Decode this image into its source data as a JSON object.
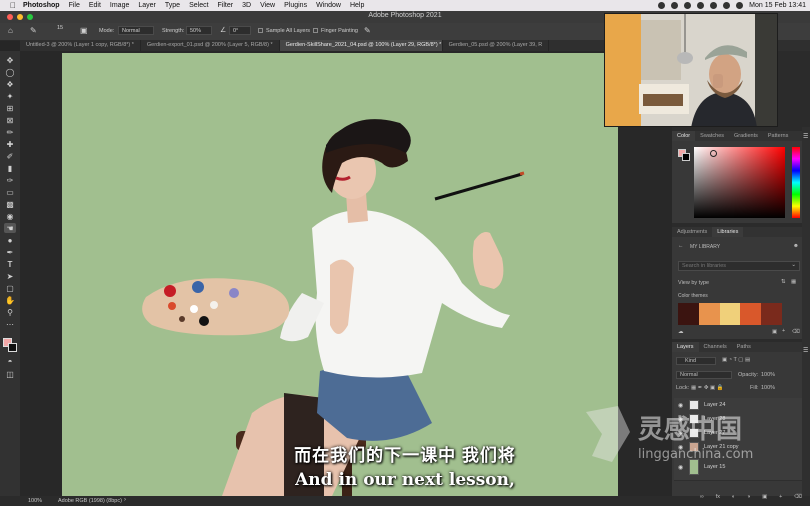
{
  "menubar": {
    "items": [
      "Photoshop",
      "File",
      "Edit",
      "Image",
      "Layer",
      "Type",
      "Select",
      "Filter",
      "3D",
      "View",
      "Plugins",
      "Window",
      "Help"
    ],
    "datetime": "Mon 15 Feb  13:41"
  },
  "titlebar": {
    "title": "Adobe Photoshop 2021"
  },
  "options": {
    "brush_size": "15",
    "mode_label": "Mode:",
    "mode_value": "Normal",
    "strength_label": "Strength:",
    "strength_value": "50%",
    "angle_value": "0°",
    "sample_all_layers": "Sample All Layers",
    "finger_painting": "Finger Painting"
  },
  "tabs": [
    {
      "label": "Untitled-3 @ 200% (Layer 1 copy, RGB/8*) *",
      "active": false
    },
    {
      "label": "Gerdien-export_01.psd @ 200% (Layer 5, RGB/8) *",
      "active": false
    },
    {
      "label": "Gerdien-SkillShare_2021_04.psd @ 100% (Layer 29, RGB/8*) *",
      "active": true
    },
    {
      "label": "Gerdien_05.psd @ 200% (Layer 39, R",
      "active": false
    }
  ],
  "status": {
    "zoom": "100%",
    "profile": "Adobe RGB (1998) (8bpc)"
  },
  "panels": {
    "color_tabs": [
      "Color",
      "Swatches",
      "Gradients",
      "Patterns"
    ],
    "lib_tabs": [
      "Adjustments",
      "Libraries"
    ],
    "my_library": "MY LIBRARY",
    "search_placeholder": "Search in libraries",
    "view_by": "View by type",
    "color_themes": "Color themes",
    "theme_colors": [
      "#3b1410",
      "#e8934d",
      "#f0d07a",
      "#d9582b",
      "#7a2a1c"
    ],
    "layer_tabs": [
      "Layers",
      "Channels",
      "Paths"
    ],
    "kind": "Kind",
    "blend": "Normal",
    "opacity_label": "Opacity:",
    "opacity": "100%",
    "lock_label": "Lock:",
    "fill_label": "Fill:",
    "fill": "100%",
    "layers": [
      "Layer 24",
      "Layer 28",
      "Layer 27",
      "Layer 21 copy",
      "Layer 15"
    ]
  },
  "subtitles": {
    "cn": "而在我们的下一课中 我们将",
    "en": "And in our next lesson,"
  },
  "watermark": {
    "cn": "灵感中国",
    "url": "lingganchina.com"
  },
  "colors": {
    "canvas_bg": "#a1bf8f",
    "foreground_swatch": "#f2a7a7",
    "accent": "#2d7cf6"
  }
}
